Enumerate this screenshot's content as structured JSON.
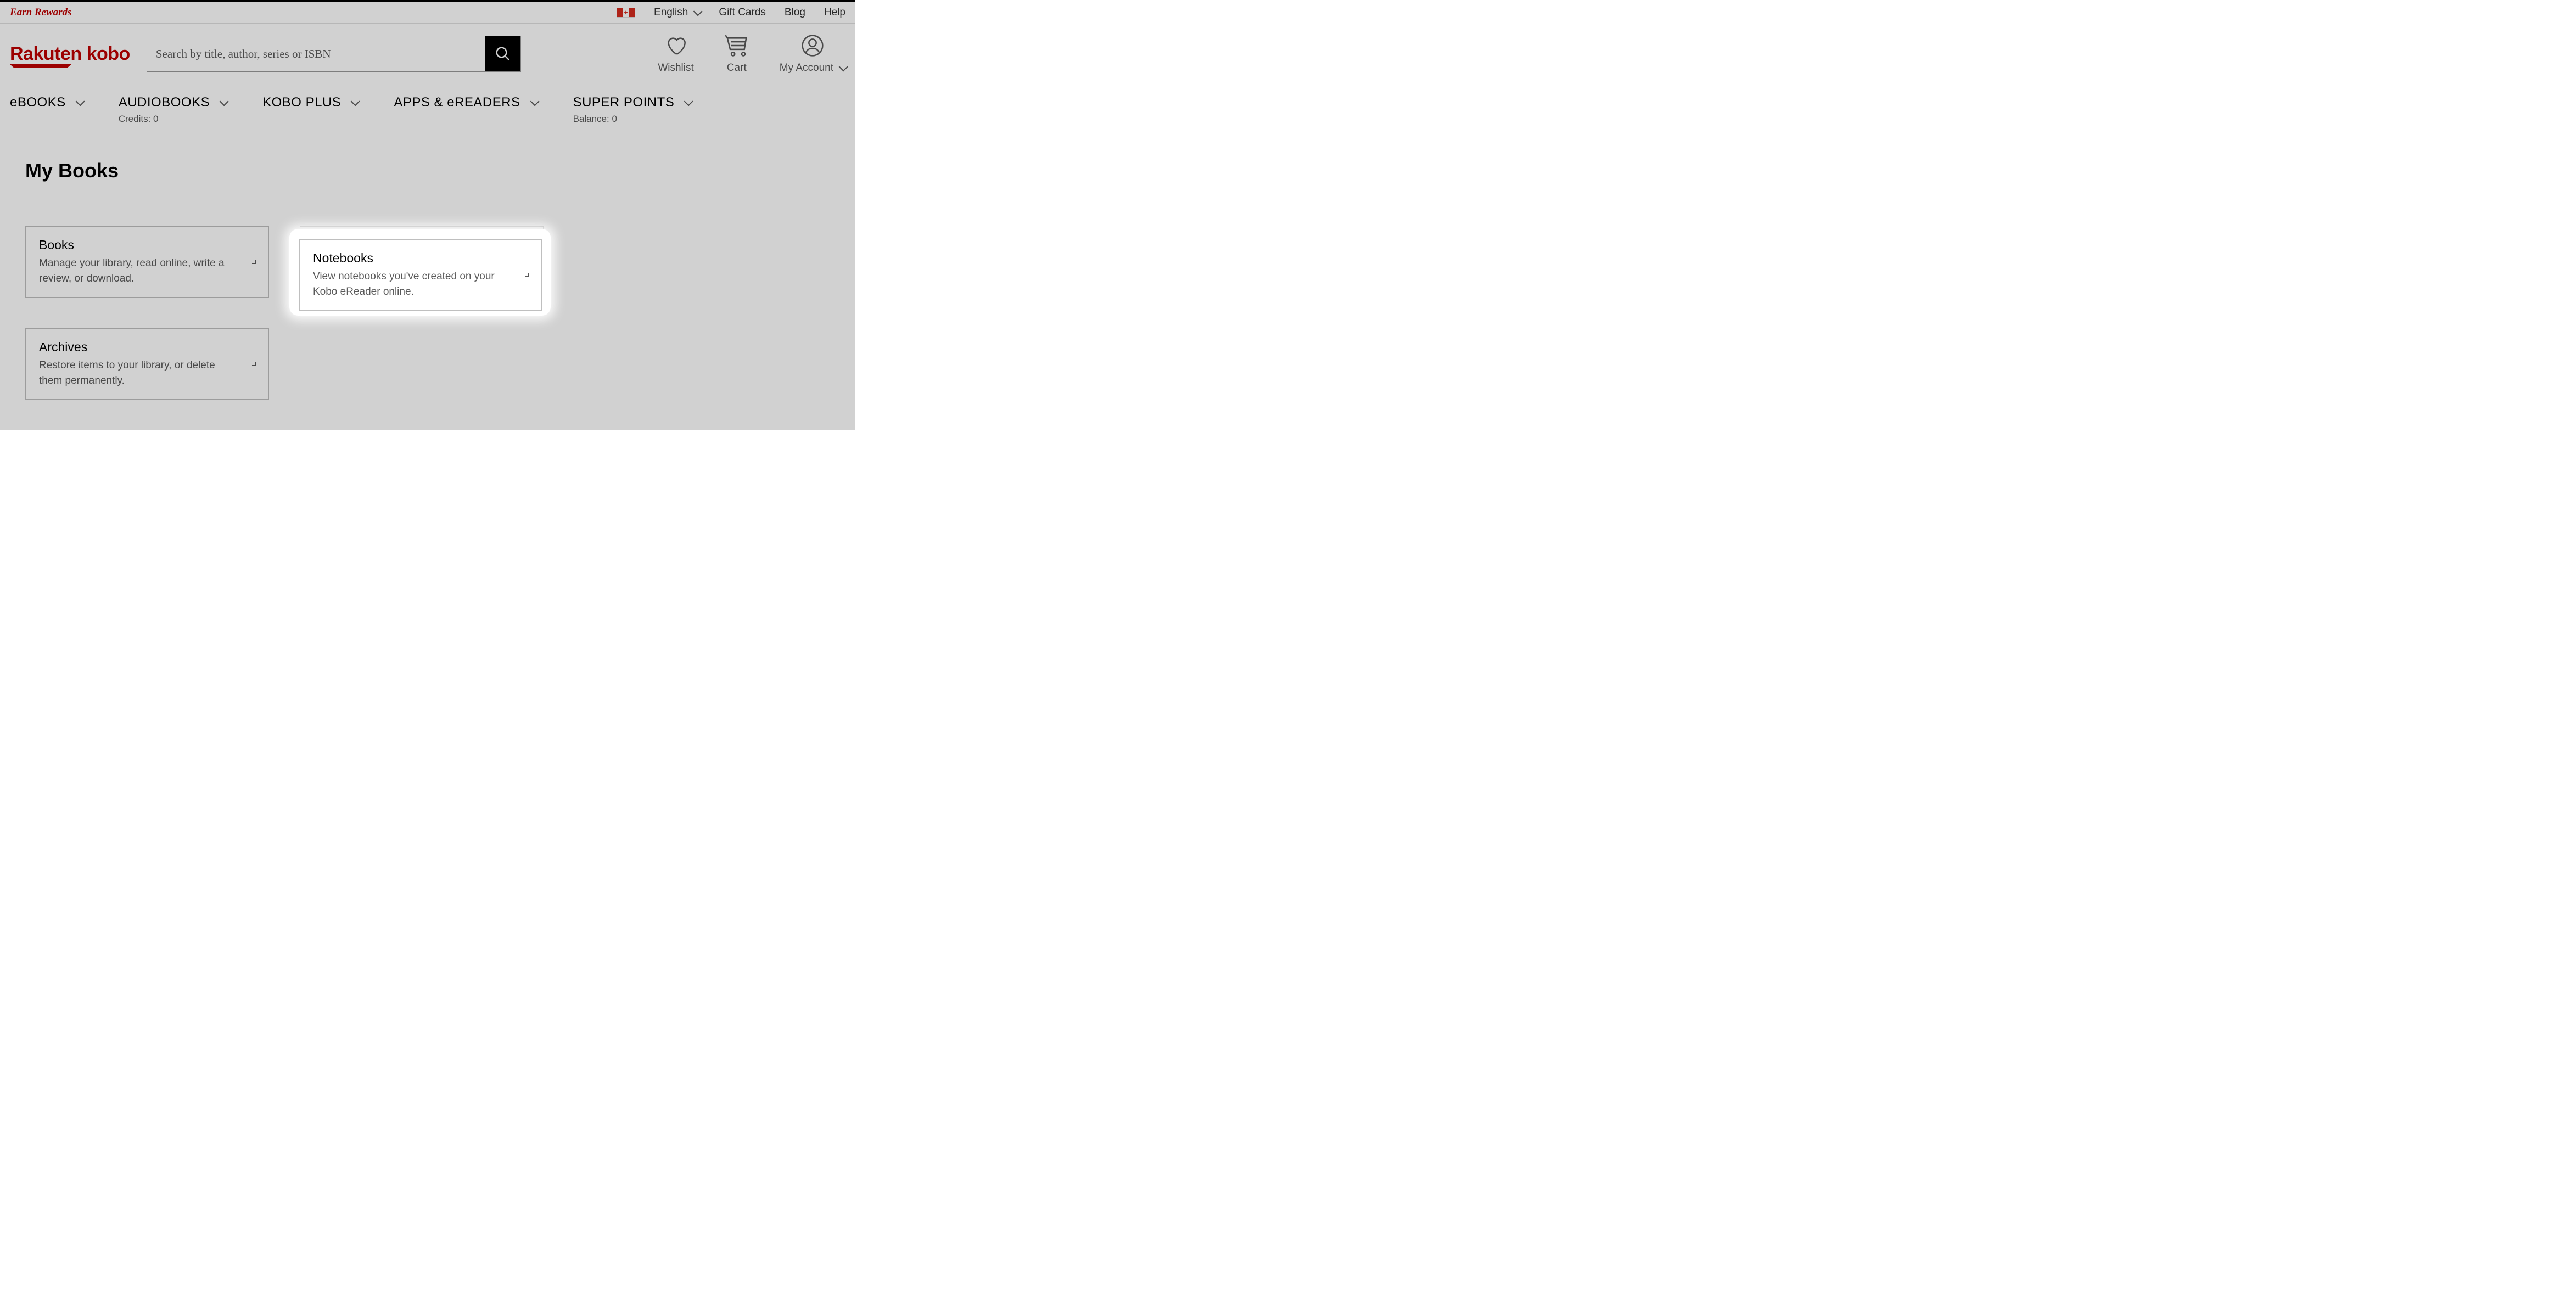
{
  "topbar": {
    "earn_rewards": "Earn Rewards",
    "language": "English",
    "gift_cards": "Gift Cards",
    "blog": "Blog",
    "help": "Help"
  },
  "header": {
    "logo": "Rakuten kobo",
    "search_placeholder": "Search by title, author, series or ISBN",
    "wishlist": "Wishlist",
    "cart": "Cart",
    "account": "My Account"
  },
  "nav": {
    "ebooks": "eBOOKS",
    "audiobooks": "AUDIOBOOKS",
    "audiobooks_sub": "Credits: 0",
    "kobo_plus": "KOBO PLUS",
    "apps": "APPS & eREADERS",
    "super_points": "SUPER POINTS",
    "super_points_sub": "Balance: 0"
  },
  "page": {
    "title": "My Books"
  },
  "cards": {
    "books": {
      "title": "Books",
      "desc": "Manage your library, read online, write a review, or download."
    },
    "notebooks": {
      "title": "Notebooks",
      "desc": "View notebooks you've created on your Kobo eReader online."
    },
    "archives": {
      "title": "Archives",
      "desc": "Restore items to your library, or delete them permanently."
    }
  }
}
